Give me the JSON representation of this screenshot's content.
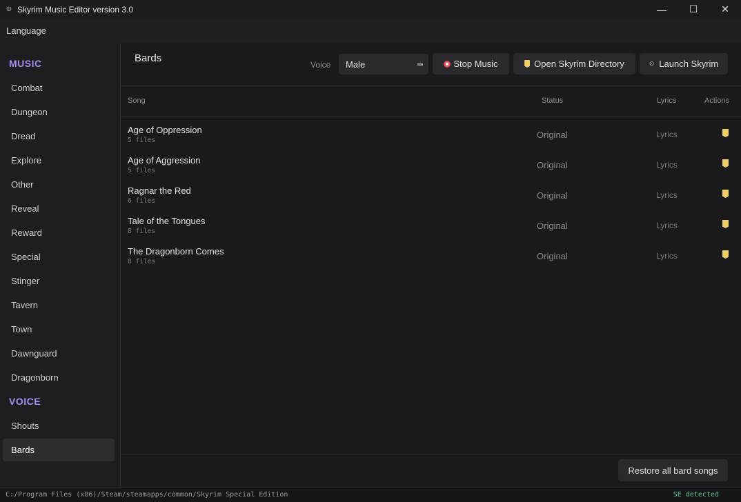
{
  "window": {
    "title": "Skyrim Music Editor version 3.0",
    "minimize": "—",
    "maximize": "☐",
    "close": "✕",
    "app_icon": "lock-icon"
  },
  "menu": {
    "language": "Language"
  },
  "sidebar": {
    "music_header": "MUSIC",
    "music_items": [
      "Combat",
      "Dungeon",
      "Dread",
      "Explore",
      "Other",
      "Reveal",
      "Reward",
      "Special",
      "Stinger",
      "Tavern",
      "Town",
      "Dawnguard",
      "Dragonborn"
    ],
    "voice_header": "VOICE",
    "voice_items": [
      "Shouts",
      "Bards"
    ],
    "active": "Bards"
  },
  "main": {
    "title": "Bards",
    "voice_label": "Voice",
    "voice_value": "Male",
    "stop_music": "Stop Music",
    "open_dir": "Open Skyrim Directory",
    "launch": "Launch Skyrim",
    "columns": {
      "song": "Song",
      "status": "Status",
      "lyrics": "Lyrics",
      "actions": "Actions"
    },
    "songs": [
      {
        "name": "Age of Oppression",
        "files": "5 files",
        "status": "Original",
        "lyrics": "Lyrics"
      },
      {
        "name": "Age of Aggression",
        "files": "5 files",
        "status": "Original",
        "lyrics": "Lyrics"
      },
      {
        "name": "Ragnar the Red",
        "files": "6 files",
        "status": "Original",
        "lyrics": "Lyrics"
      },
      {
        "name": "Tale of the Tongues",
        "files": "8 files",
        "status": "Original",
        "lyrics": "Lyrics"
      },
      {
        "name": "The Dragonborn Comes",
        "files": "8 files",
        "status": "Original",
        "lyrics": "Lyrics"
      }
    ],
    "restore": "Restore all bard songs"
  },
  "status": {
    "path": "C:/Program Files (x86)/Steam/steamapps/common/Skyrim Special Edition",
    "detected": "SE detected"
  },
  "colors": {
    "accent": "#a48cf0",
    "folder": "#f0cf6a",
    "stop": "#e24d55",
    "detected": "#5fc48a"
  }
}
